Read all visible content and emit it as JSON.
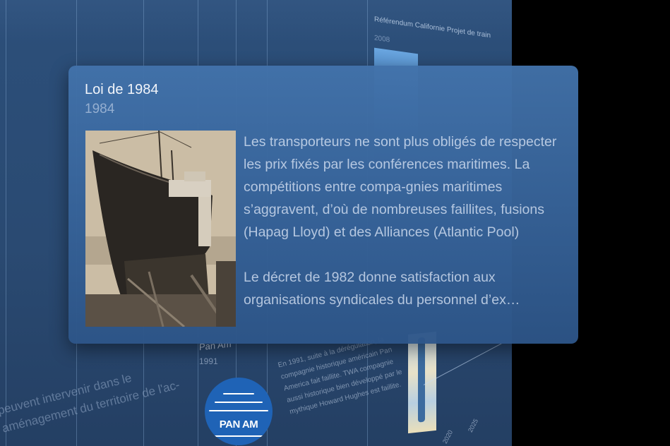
{
  "background": {
    "referendum": {
      "title": "Référendum Californie Projet de train",
      "year": "2008"
    },
    "panam": {
      "title": "Pan Am",
      "year": "1991",
      "logo_text": "PAN AM",
      "text": "En 1991, suite à la dérégulation, la compagnie historique américain Pan America fait faillite. TWA compagnie aussi historique bien développé par le mythique Howard Hughes est faillite."
    },
    "left_text": "peuvent intervenir dans le aménagement du territoire de l'ac-",
    "ticks": [
      "2025",
      "2020"
    ]
  },
  "card": {
    "title": "Loi de 1984",
    "year": "1984",
    "photo": "cargo-ship-launch-photo",
    "paragraph1": "Les transporteurs ne sont plus obligés de respecter les prix fixés par les conférences maritimes. La compétitions entre compa-gnies maritimes s’aggravent, d’où de nombreuses faillites, fusions (Hapag Lloyd) et des Alliances (Atlantic Pool)",
    "paragraph2_line1": "Le décret de 1982 donne satisfaction aux",
    "paragraph2_line2": "organisations syndicales du personnel d’ex…"
  },
  "colors": {
    "panel": "#2c4f7a",
    "card": "#4272aa",
    "panam_blue": "#1f63b6"
  }
}
